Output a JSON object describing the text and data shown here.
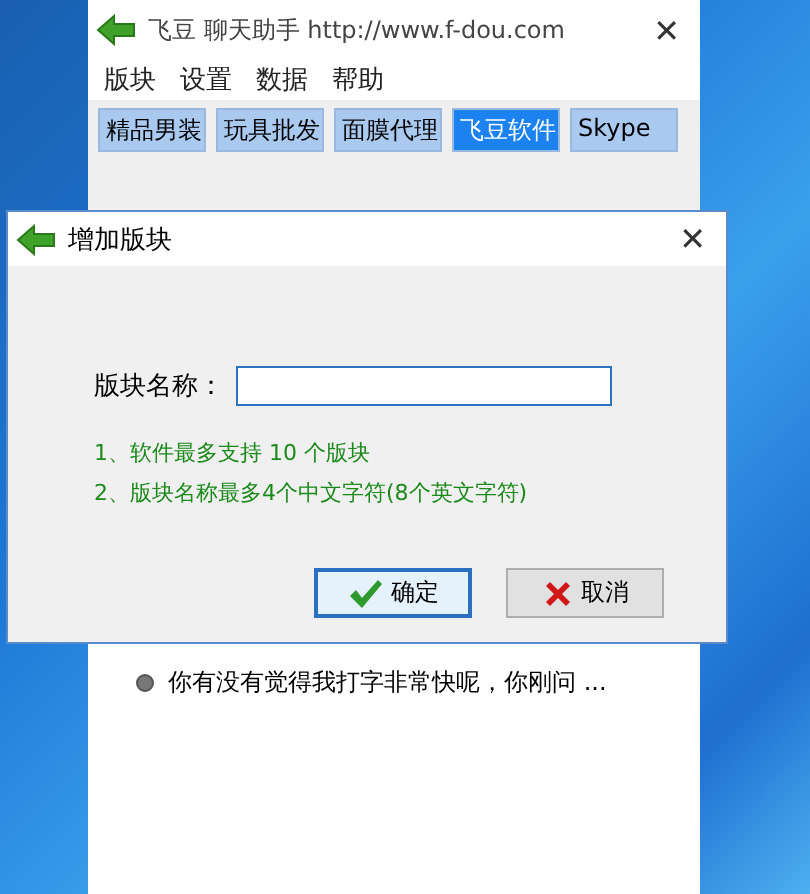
{
  "main_window": {
    "title": "飞豆 聊天助手 http://www.f-dou.com",
    "close": "✕",
    "menu": [
      "版块",
      "设置",
      "数据",
      "帮助"
    ],
    "tabs": [
      {
        "label": "精品男装",
        "selected": false
      },
      {
        "label": "玩具批发",
        "selected": false
      },
      {
        "label": "面膜代理",
        "selected": false
      },
      {
        "label": "飞豆软件",
        "selected": true
      },
      {
        "label": "Skype",
        "selected": false
      }
    ],
    "messages": [
      "你有没有觉得我打字非常快呢，你刚问 ..."
    ]
  },
  "dialog": {
    "title": "增加版块",
    "close": "✕",
    "field_label": "版块名称：",
    "notes": [
      "1、软件最多支持 10 个版块",
      "2、版块名称最多4个中文字符(8个英文字符)"
    ],
    "buttons": [
      {
        "kind": "ok",
        "label": "确定",
        "focused": true
      },
      {
        "kind": "cancel",
        "label": "取消",
        "focused": false
      }
    ]
  }
}
